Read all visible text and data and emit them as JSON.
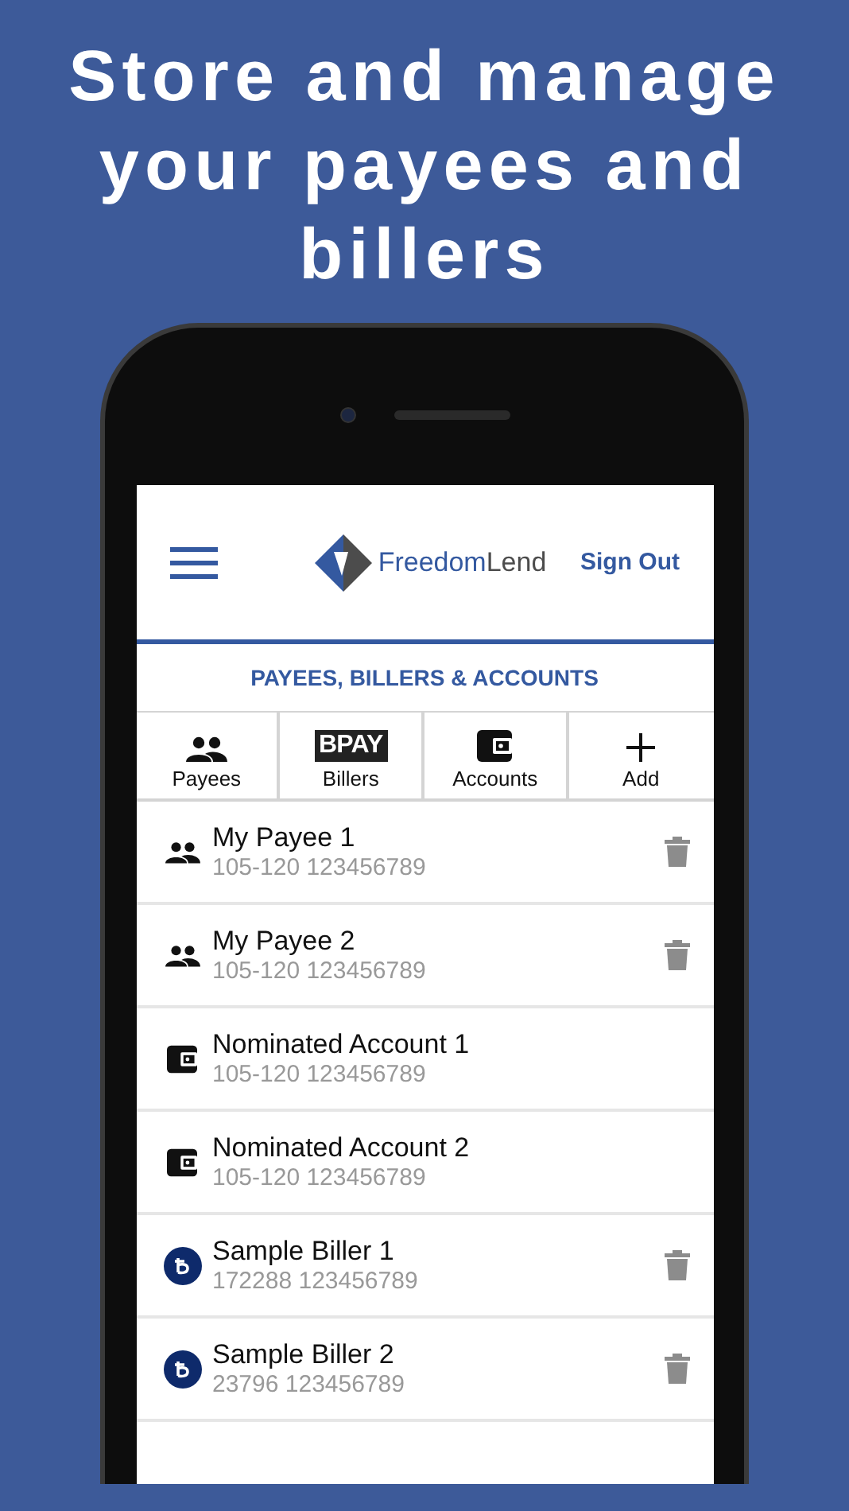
{
  "headline": "Store and manage your payees and billers",
  "header": {
    "logo": {
      "primary": "Freedom",
      "secondary": "Lend"
    },
    "action": "Sign Out"
  },
  "section_title": "PAYEES, BILLERS & ACCOUNTS",
  "tabs": [
    {
      "kind": "payees",
      "label": "Payees"
    },
    {
      "kind": "billers",
      "label": "Billers",
      "icon_text": "BPAY"
    },
    {
      "kind": "accounts",
      "label": "Accounts"
    },
    {
      "kind": "add",
      "label": "Add"
    }
  ],
  "items": [
    {
      "kind": "payee",
      "name": "My Payee 1",
      "detail": "105-120 123456789",
      "deletable": true
    },
    {
      "kind": "payee",
      "name": "My Payee 2",
      "detail": "105-120 123456789",
      "deletable": true
    },
    {
      "kind": "account",
      "name": "Nominated Account 1",
      "detail": "105-120 123456789",
      "deletable": false
    },
    {
      "kind": "account",
      "name": "Nominated Account 2",
      "detail": "105-120 123456789",
      "deletable": false
    },
    {
      "kind": "biller",
      "name": "Sample Biller 1",
      "detail": "172288 123456789",
      "deletable": true
    },
    {
      "kind": "biller",
      "name": "Sample Biller 2",
      "detail": "23796 123456789",
      "deletable": true
    }
  ]
}
